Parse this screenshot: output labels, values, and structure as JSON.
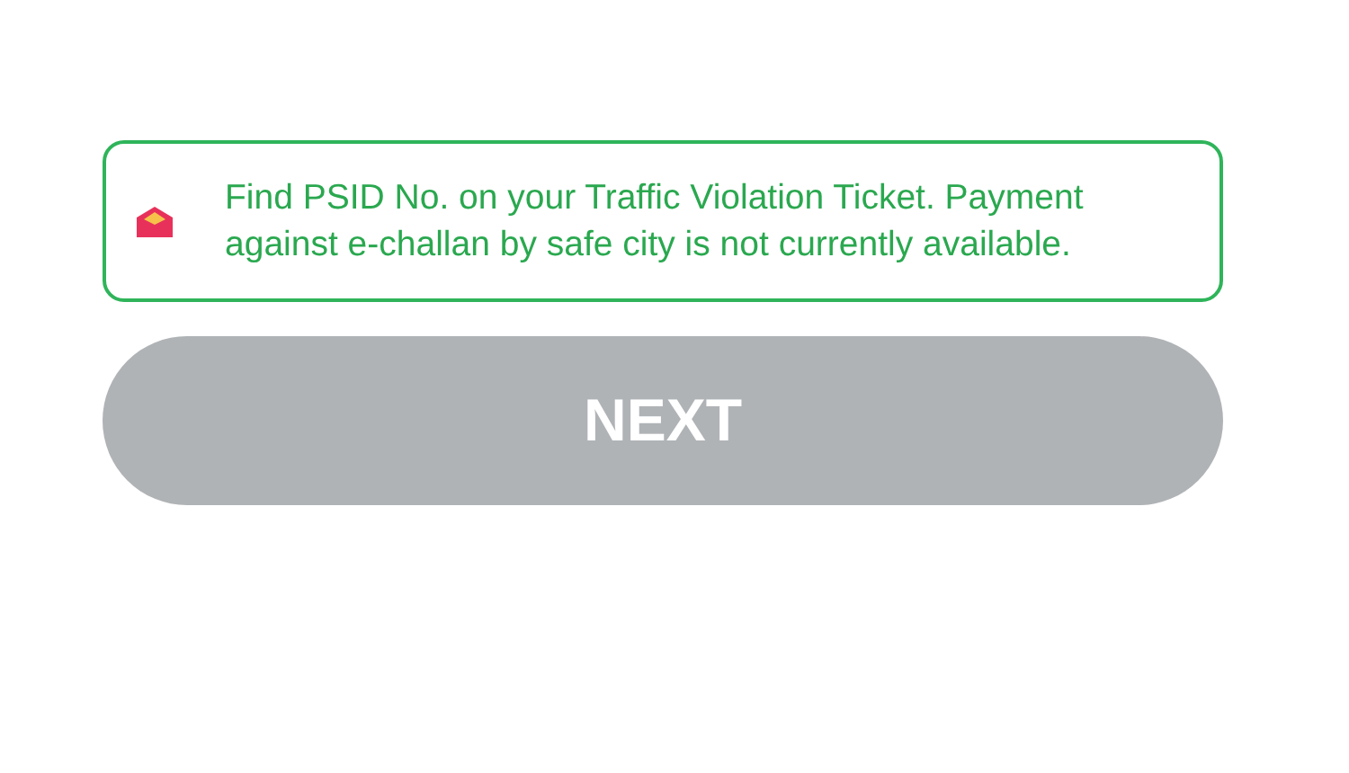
{
  "notice": {
    "text": "Find PSID No. on your Traffic Violation Ticket. Payment against e-challan by safe city is not currently available."
  },
  "next_button": {
    "label": "NEXT",
    "disabled": true
  }
}
